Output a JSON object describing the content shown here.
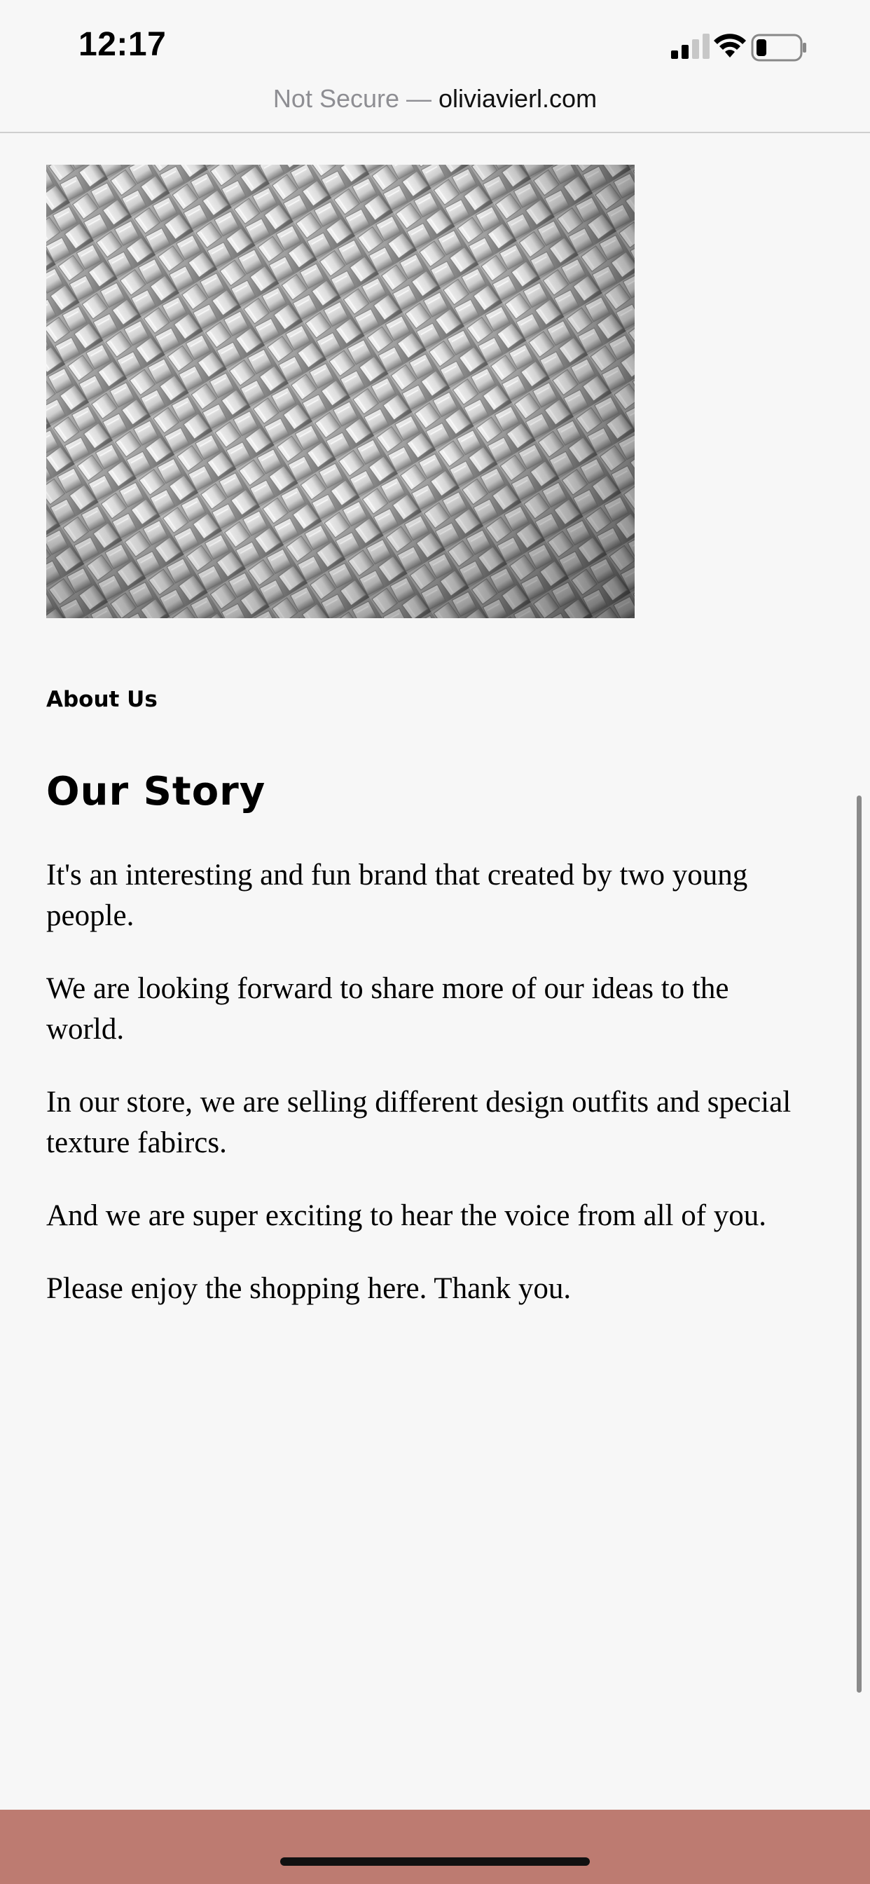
{
  "status_bar": {
    "time": "12:17",
    "icons": [
      "signal-icon",
      "wifi-icon",
      "battery-icon"
    ]
  },
  "url_bar": {
    "security_label": "Not Secure — ",
    "domain": "oliviavierl.com"
  },
  "hero": {
    "icon": "woven-fabric-texture-image"
  },
  "about": {
    "label": "About Us",
    "title": "Our Story",
    "paragraphs": [
      "It's an interesting and fun brand that created by two young people.",
      "We are looking forward to share more of our ideas to the world.",
      "In our store, we are selling different design outfits and special texture fabircs.",
      "And we are super exciting to hear the voice from all of you.",
      "Please enjoy the shopping here. Thank you."
    ]
  },
  "colors": {
    "background": "#f7f7f7",
    "footer": "#bd7b71",
    "text": "#000000",
    "url_insecure": "#8e8e93"
  }
}
